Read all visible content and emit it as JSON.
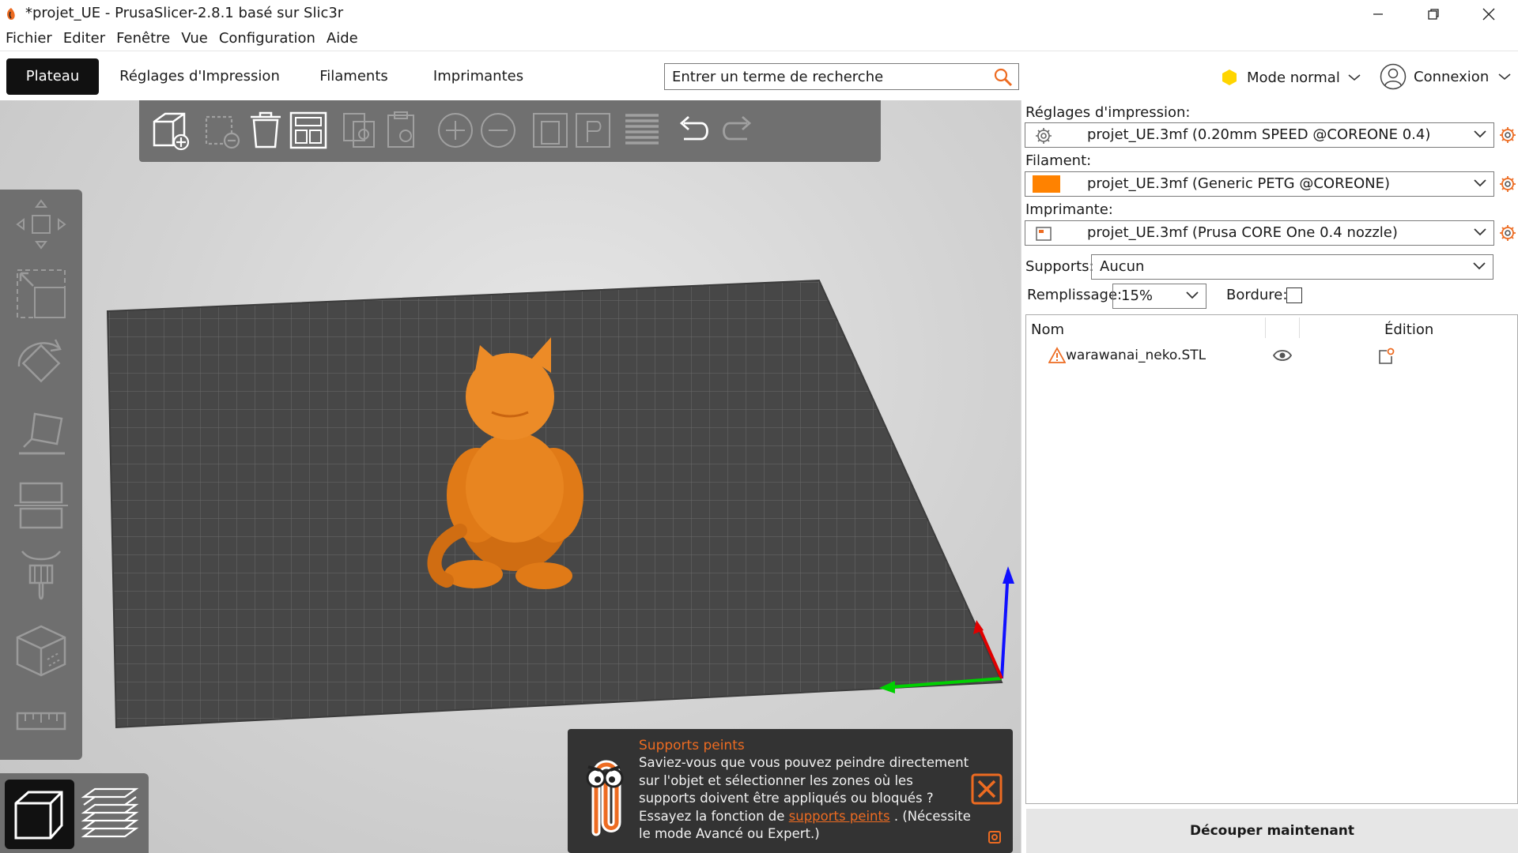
{
  "window": {
    "title": "*projet_UE - PrusaSlicer-2.8.1 basé sur Slic3r",
    "icon": "prusa-logo-icon"
  },
  "menu": [
    "Fichier",
    "Editer",
    "Fenêtre",
    "Vue",
    "Configuration",
    "Aide"
  ],
  "tabs": [
    {
      "label": "Plateau",
      "active": true
    },
    {
      "label": "Réglages d'Impression",
      "active": false
    },
    {
      "label": "Filaments",
      "active": false
    },
    {
      "label": "Imprimantes",
      "active": false
    }
  ],
  "search": {
    "placeholder": "Entrer un terme de recherche"
  },
  "mode": {
    "label": "Mode normal",
    "color": "#ffd500"
  },
  "account": {
    "label": "Connexion"
  },
  "toolbar_icons": [
    "add-icon",
    "delete-icon",
    "delete-all-icon",
    "arrange-icon",
    "copy-icon",
    "paste-icon",
    "add-instance-icon",
    "remove-instance-icon",
    "split-objects-icon",
    "split-parts-icon",
    "layers-editing-icon",
    "undo-icon",
    "redo-icon"
  ],
  "gizmo_icons": [
    "move-icon",
    "scale-icon",
    "rotate-icon",
    "place-on-face-icon",
    "cut-icon",
    "support-paint-icon",
    "measure-cube-icon",
    "ruler-icon"
  ],
  "view_buttons": [
    "3d-view-icon",
    "preview-layers-icon"
  ],
  "hint": {
    "title": "Supports peints",
    "text_before": "Saviez-vous que vous pouvez peindre directement sur l'objet et sélectionner les zones où les supports doivent être appliqués ou bloqués ? Essayez la fonction de ",
    "link": "supports peints",
    "text_after": " . (Nécessite le mode Avancé ou Expert.)"
  },
  "settings": {
    "print_label": "Réglages d'impression:",
    "print_value": "projet_UE.3mf (0.20mm SPEED @COREONE 0.4)",
    "filament_label": "Filament:",
    "filament_value": "projet_UE.3mf (Generic PETG @COREONE)",
    "filament_color": "#ff8200",
    "printer_label": "Imprimante:",
    "printer_value": "projet_UE.3mf (Prusa CORE One 0.4 nozzle)",
    "supports_label": "Supports:",
    "supports_value": "Aucun",
    "infill_label": "Remplissage:",
    "infill_value": "15%",
    "brim_label": "Bordure:",
    "brim_checked": false
  },
  "object_list": {
    "col_name": "Nom",
    "col_edit": "Édition",
    "objects": [
      {
        "name": "warawanai_neko.STL",
        "warning": true,
        "visible": true
      }
    ]
  },
  "slice_button": "Découper maintenant",
  "colors": {
    "accent": "#ed6b21",
    "model": "#e07a17",
    "bed": "#4a4a4a"
  }
}
